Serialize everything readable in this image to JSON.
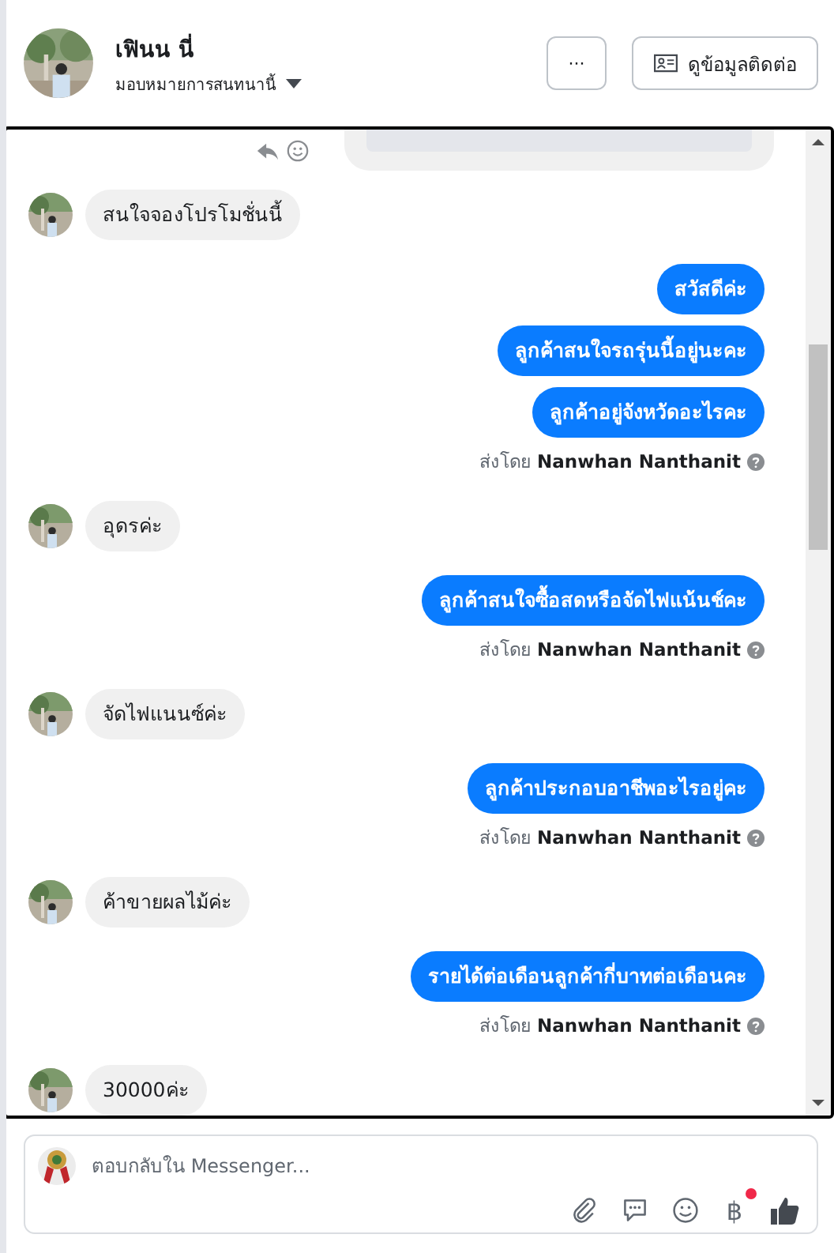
{
  "header": {
    "name": "เฟินน นี่",
    "assign_label": "มอบหมายการสนทนานี้",
    "more_button": "···",
    "contact_button": "ดูข้อมูลติดต่อ"
  },
  "messages": [
    {
      "kind": "received",
      "text": "สนใจจองโปรโมชั่นนี้"
    },
    {
      "kind": "sent",
      "text": "สวัสดีค่ะ"
    },
    {
      "kind": "sent",
      "text": "ลูกค้าสนใจรถรุ่นนี้อยู่นะคะ"
    },
    {
      "kind": "sent",
      "text": "ลูกค้าอยู่จังหวัดอะไรคะ"
    },
    {
      "kind": "sent_by",
      "prefix": "ส่งโดย",
      "name": "Nanwhan Nanthanit"
    },
    {
      "kind": "received",
      "text": "อุดรค่ะ"
    },
    {
      "kind": "sent",
      "text": "ลูกค้าสนใจซื้อสดหรือจัดไฟแน้นช์คะ"
    },
    {
      "kind": "sent_by",
      "prefix": "ส่งโดย",
      "name": "Nanwhan Nanthanit"
    },
    {
      "kind": "received",
      "text": "จัดไฟแนนซ์ค่ะ"
    },
    {
      "kind": "sent",
      "text": "ลูกค้าประกอบอาชีพอะไรอยู่คะ"
    },
    {
      "kind": "sent_by",
      "prefix": "ส่งโดย",
      "name": "Nanwhan Nanthanit"
    },
    {
      "kind": "received",
      "text": "ค้าขายผลไม้ค่ะ"
    },
    {
      "kind": "sent",
      "text": "รายได้ต่อเดือนลูกค้ากี่บาทต่อเดือนคะ"
    },
    {
      "kind": "sent_by",
      "prefix": "ส่งโดย",
      "name": "Nanwhan Nanthanit"
    },
    {
      "kind": "received",
      "text": "30000ค่ะ"
    }
  ],
  "composer": {
    "placeholder": "ตอบกลับใน Messenger...",
    "currency_symbol": "฿",
    "currency_notification": true
  }
}
